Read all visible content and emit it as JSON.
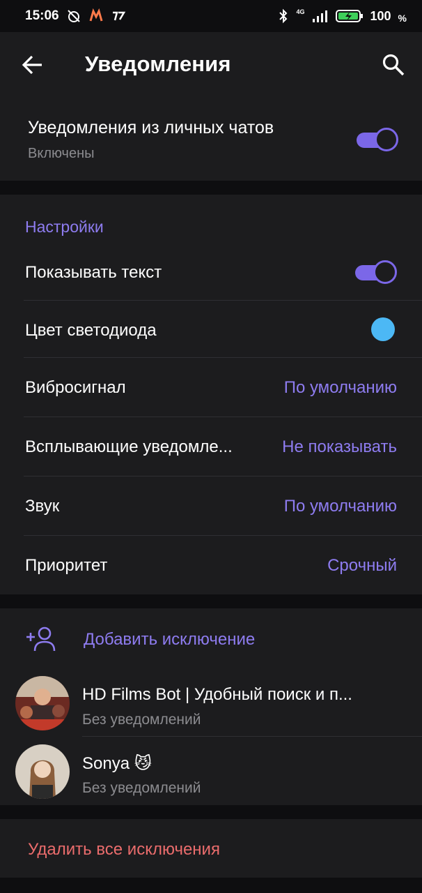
{
  "status_bar": {
    "time": "15:06",
    "network": "4G",
    "battery": "100",
    "battery_unit": "%"
  },
  "header": {
    "title": "Уведомления"
  },
  "private_chats": {
    "title": "Уведомления из личных чатов",
    "subtitle": "Включены",
    "enabled": true
  },
  "settings": {
    "header": "Настройки",
    "show_text_label": "Показывать текст",
    "show_text_enabled": true,
    "led_label": "Цвет светодиода",
    "led_color": "#4cb8f5",
    "vibrate_label": "Вибросигнал",
    "vibrate_value": "По умолчанию",
    "popup_label": "Всплывающие уведомле...",
    "popup_value": "Не показывать",
    "sound_label": "Звук",
    "sound_value": "По умолчанию",
    "priority_label": "Приоритет",
    "priority_value": "Срочный"
  },
  "exceptions": {
    "add_label": "Добавить исключение",
    "items": [
      {
        "name": "HD Films Bot | Удобный поиск и п...",
        "status": "Без уведомлений"
      },
      {
        "name": "Sonya 😼",
        "status": "Без уведомлений"
      }
    ]
  },
  "delete_all_label": "Удалить все исключения",
  "colors": {
    "accent": "#8e7cf0",
    "danger": "#ea6c6c",
    "panel": "#1c1c1e",
    "background": "#0e0e10"
  }
}
